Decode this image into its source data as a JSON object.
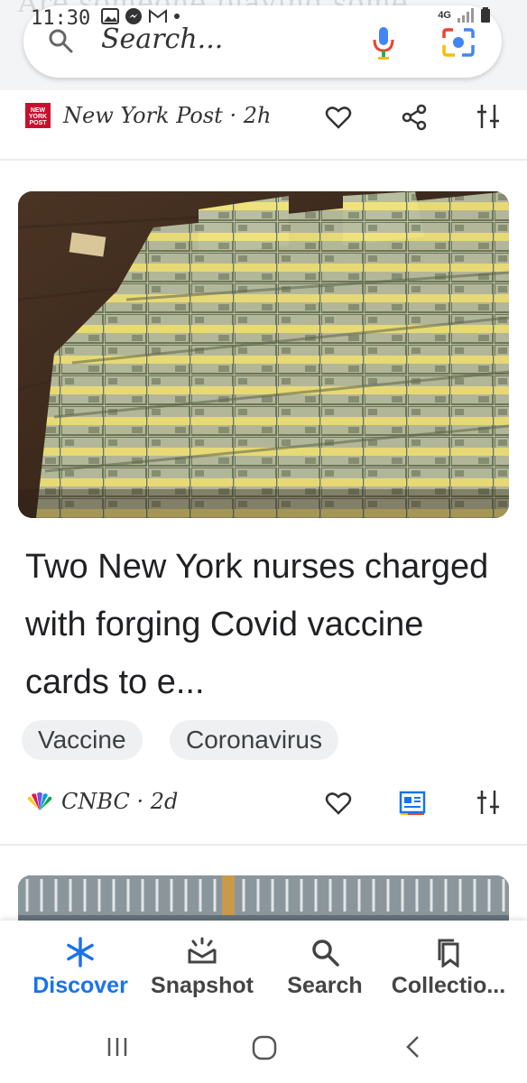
{
  "status_bar": {
    "time": "11:30",
    "network": "4G"
  },
  "ghost_text": "Are someone playing some",
  "search": {
    "placeholder": "Search..."
  },
  "articles": [
    {
      "source": "New York Post · 2h",
      "source_logo_text": "NEW YORK POST",
      "image_icon": "stacks-of-cash-photo"
    },
    {
      "headline": "Two New York nurses charged with forging Covid vaccine cards to e...",
      "chips": [
        "Vaccine",
        "Coronavirus"
      ],
      "source": "CNBC · 2d",
      "source_logo": "peacock-logo"
    }
  ],
  "bottom_nav": {
    "items": [
      {
        "label": "Discover",
        "icon": "asterisk-icon",
        "active": true
      },
      {
        "label": "Snapshot",
        "icon": "snapshot-icon",
        "active": false
      },
      {
        "label": "Search",
        "icon": "search-icon",
        "active": false
      },
      {
        "label": "Collectio...",
        "icon": "bookmark-icon",
        "active": false
      }
    ]
  },
  "colors": {
    "accent": "#1a73e8",
    "chip_bg": "#eef0f2",
    "text": "#202124",
    "news_red": "#c8102e"
  }
}
